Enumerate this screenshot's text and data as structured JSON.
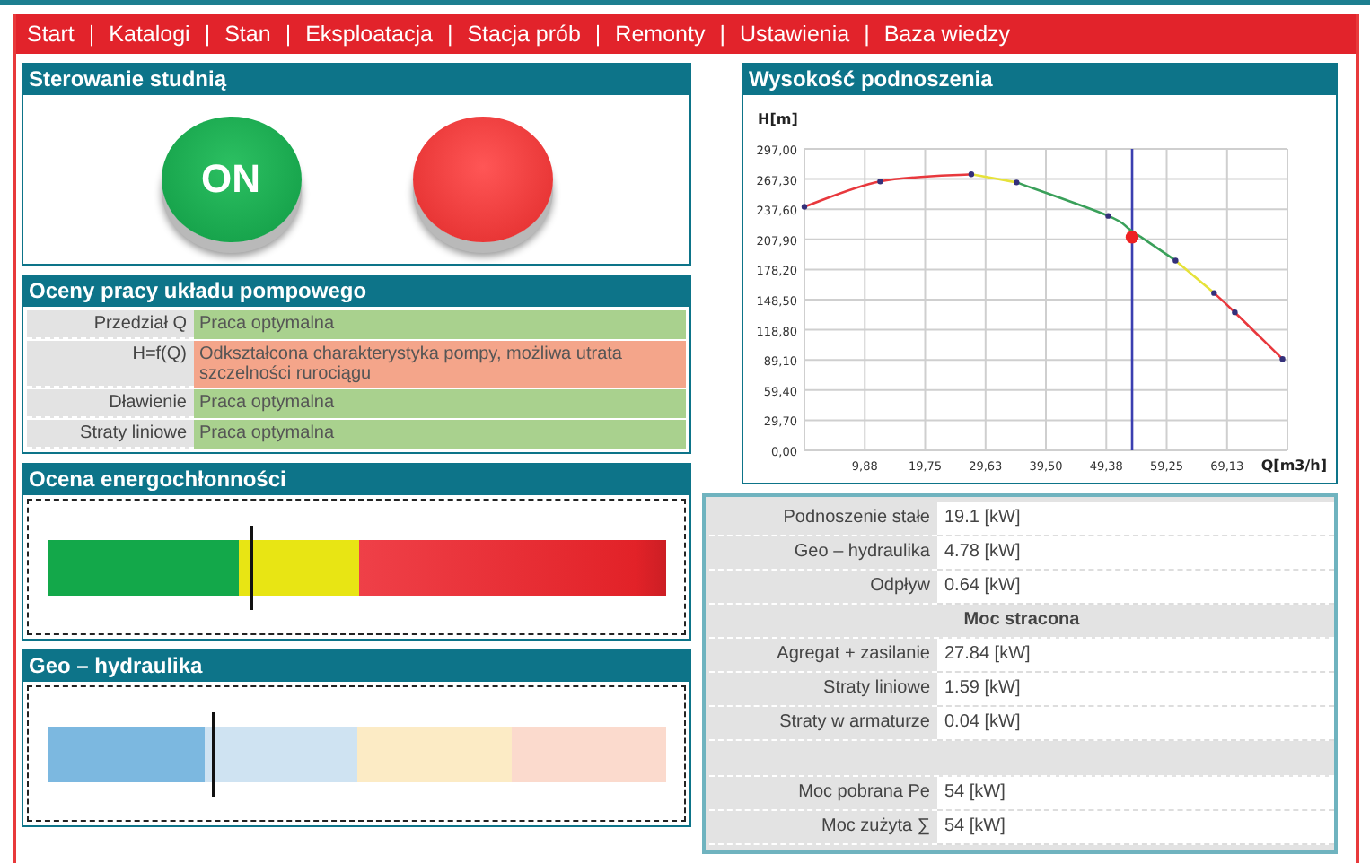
{
  "nav": {
    "separator": "|",
    "items": [
      "Start",
      "Katalogi",
      "Stan",
      "Eksploatacja",
      "Stacja prób",
      "Remonty",
      "Ustawienia",
      "Baza wiedzy"
    ]
  },
  "control": {
    "title": "Sterowanie studnią",
    "buttons": [
      {
        "kind": "on",
        "label": "ON"
      },
      {
        "kind": "off"
      }
    ]
  },
  "evaluation": {
    "title": "Oceny pracy układu pompowego",
    "rows": [
      {
        "label": "Przedział Q",
        "value": "Praca optymalna",
        "color": "#a9d18e"
      },
      {
        "label": "H=f(Q)",
        "value": "Odkształcona charakterystyka pompy, możliwa utrata szczelności rurociągu",
        "color": "#f4a58a"
      },
      {
        "label": "Dławienie",
        "value": "Praca optymalna",
        "color": "#a9d18e"
      },
      {
        "label": "Straty liniowe",
        "value": "Praca optymalna",
        "color": "#a9d18e"
      }
    ]
  },
  "gauges": [
    {
      "title": "Ocena energochłonności",
      "kind": "energy",
      "level": 0.33
    },
    {
      "title": "Geo – hydraulika",
      "kind": "geo",
      "level": 0.27
    }
  ],
  "head_chart": {
    "title": "Wysokość podnoszenia",
    "chart_data": {
      "type": "line",
      "xlabel": "Q[m3/h]",
      "ylabel": "H[m]",
      "grid": true,
      "x": [
        0,
        12.4,
        27.3,
        34.7,
        49.7,
        53.6,
        60.7,
        67,
        70.4,
        78.2
      ],
      "series": [
        {
          "color": "#e8383d",
          "marker": true,
          "values": [
            240,
            265,
            272,
            null,
            null,
            null,
            null,
            155,
            136,
            90
          ]
        },
        {
          "color": "#e6e23a",
          "marker": true,
          "values": [
            null,
            null,
            272,
            264,
            null,
            null,
            187,
            155,
            null,
            null
          ]
        },
        {
          "color": "#3aa05a",
          "marker": true,
          "values": [
            null,
            null,
            null,
            264,
            231,
            216,
            187,
            null,
            null,
            null
          ]
        },
        {
          "color": "#ee2222",
          "marker": true,
          "values": [
            null,
            null,
            null,
            null,
            null,
            210,
            null,
            null,
            null,
            null
          ]
        }
      ],
      "ref_lines": [
        {
          "axis": "x",
          "value": 53.6,
          "color": "#3b3fb0"
        }
      ],
      "xlim": [
        0,
        79
      ],
      "ylim": [
        0,
        297
      ],
      "xticks": [
        {
          "value": 9.88,
          "label": "9,88"
        },
        {
          "value": 19.75,
          "label": "19,75"
        },
        {
          "value": 29.63,
          "label": "29,63"
        },
        {
          "value": 39.5,
          "label": "39,50"
        },
        {
          "value": 49.38,
          "label": "49,38"
        },
        {
          "value": 59.25,
          "label": "59,25"
        },
        {
          "value": 69.13,
          "label": "69,13"
        }
      ],
      "yticks": [
        {
          "value": 0,
          "label": "0,00"
        },
        {
          "value": 29.7,
          "label": "29,70"
        },
        {
          "value": 59.4,
          "label": "59,40"
        },
        {
          "value": 89.1,
          "label": "89,10"
        },
        {
          "value": 118.8,
          "label": "118,80"
        },
        {
          "value": 148.5,
          "label": "148,50"
        },
        {
          "value": 178.2,
          "label": "178,20"
        },
        {
          "value": 207.9,
          "label": "207,90"
        },
        {
          "value": 237.6,
          "label": "237,60"
        },
        {
          "value": 267.3,
          "label": "267,30"
        },
        {
          "value": 297,
          "label": "297,00"
        }
      ]
    }
  },
  "power": {
    "rows": [
      {
        "kind": "row",
        "label": "Podnoszenie stałe",
        "value": "19.1 [kW]"
      },
      {
        "kind": "row",
        "label": "Geo – hydraulika",
        "value": "4.78 [kW]"
      },
      {
        "kind": "row",
        "label": "Odpływ",
        "value": "0.64 [kW]"
      },
      {
        "kind": "heading",
        "label": "Moc stracona"
      },
      {
        "kind": "row",
        "label": "Agregat + zasilanie",
        "value": "27.84 [kW]"
      },
      {
        "kind": "row",
        "label": "Straty liniowe",
        "value": "1.59 [kW]"
      },
      {
        "kind": "row",
        "label": "Straty w armaturze",
        "value": "0.04 [kW]"
      },
      {
        "kind": "blank"
      },
      {
        "kind": "row",
        "label": "Moc pobrana Pe",
        "value": "54 [kW]"
      },
      {
        "kind": "row",
        "label": "Moc zużyta ∑",
        "value": "54 [kW]"
      }
    ]
  }
}
